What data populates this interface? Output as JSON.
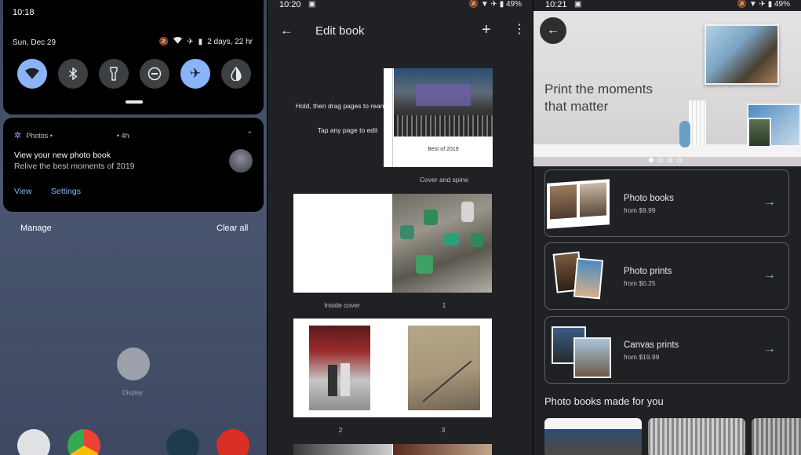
{
  "screen1": {
    "time": "10:18",
    "date": "Sun, Dec 29",
    "battery_text": "2 days, 22 hr",
    "tiles": [
      "wifi-icon",
      "bluetooth-icon",
      "flashlight-icon",
      "dnd-icon",
      "airplane-icon",
      "invert-icon"
    ],
    "notification": {
      "app": "Photos •",
      "age": "• 4h",
      "title": "View your new photo book",
      "body": "Relive the best moments of 2019",
      "action_view": "View",
      "action_settings": "Settings"
    },
    "manage": "Manage",
    "clear_all": "Clear all",
    "display_label": "Display"
  },
  "screen2": {
    "time": "10:20",
    "battery": "49%",
    "title": "Edit book",
    "hint1": "Hold, then drag pages to rearrange",
    "hint2": "Tap any page to edit",
    "cover_caption": "Best of 2019",
    "cover_label": "Cover and spine",
    "label_inside_cover": "Inside cover",
    "label_1": "1",
    "label_2": "2",
    "label_3": "3"
  },
  "screen3": {
    "time": "10:21",
    "battery": "49%",
    "hero_text_1": "Print the moments",
    "hero_text_2": "that matter",
    "products": [
      {
        "title": "Photo books",
        "price": "from $9.99"
      },
      {
        "title": "Photo prints",
        "price": "from $0.25"
      },
      {
        "title": "Canvas prints",
        "price": "from $19.99"
      }
    ],
    "section_title": "Photo books made for you"
  },
  "colors": {
    "accent": "#8ab4f8",
    "surface": "#202124",
    "card_border": "#5f6368"
  }
}
